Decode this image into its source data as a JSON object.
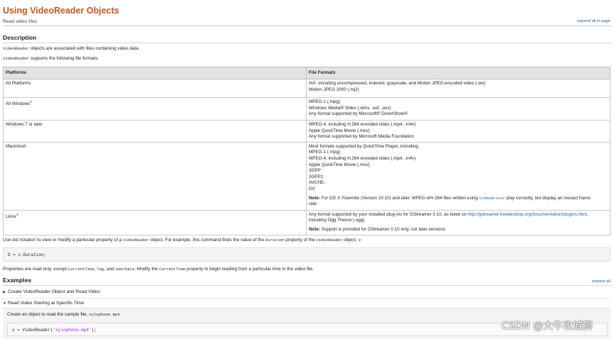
{
  "header": {
    "title": "Using VideoReader Objects",
    "subtitle": "Read video files",
    "expand_all_in_page": "expand all in page"
  },
  "description": {
    "heading": "Description",
    "line1_code": "VideoReader",
    "line1_text": " objects are associated with files containing video data.",
    "line2_code": "VideoReader",
    "line2_text": " supports the following file formats."
  },
  "formats_table": {
    "headers": [
      "Platforms",
      "File Formats"
    ],
    "rows": [
      {
        "platform": "All Platforms",
        "sup": "",
        "lines": [
          "AVI, including uncompressed, indexed, grayscale, and Motion JPEG-encoded video (.avi)",
          "Motion JPEG 2000 (.mj2)"
        ]
      },
      {
        "platform": "All Windows",
        "sup": "®",
        "lines": [
          "MPEG-1 (.mpg)",
          "Windows Media® Video (.wmv, .asf, .asx)",
          "Any format supported by Microsoft® DirectShow®"
        ]
      },
      {
        "platform": "Windows 7 or later",
        "sup": "",
        "lines": [
          "MPEG-4, including H.264 encoded video (.mp4, .m4v)",
          "Apple QuickTime Movie (.mov)",
          "Any format supported by Microsoft Media Foundation"
        ]
      },
      {
        "platform": "Macintosh",
        "sup": "",
        "lines": [
          "Most formats supported by QuickTime Player, including:",
          "MPEG-1 (.mpg)",
          "MPEG-4, including H.264 encoded video (.mp4, .m4v)",
          "Apple QuickTime Movie (.mov)",
          "3GPP",
          "3GPP2",
          "AVCHD",
          "DV"
        ],
        "note_label": "Note:",
        "note_text": " For OS X Yosemite (Version 10.10) and later, MPEG-4/H.264 files written using ",
        "note_code": "VideoWriter",
        "note_text2": " play correctly, but display an inexact frame",
        "note_text3": "rate."
      },
      {
        "platform": "Linux",
        "sup": "®",
        "line1_pre": "Any format supported by your installed plug-ins for GStreamer 0.10, as listed on ",
        "line1_link": "http://gstreamer.freedesktop.org/documentation/plugins.html",
        "line1_post": ",",
        "line2": "including Ogg Theora (.ogg).",
        "note_label": "Note:",
        "note_text": " Support is provided for GStreamer 0.10 only, not later versions."
      }
    ]
  },
  "dot_notation": {
    "t1": "Use dot notation to view or modify a particular property of a ",
    "c1": "VideoReader",
    "t2": " object. For example, this command finds the value of the ",
    "c2": "Duration",
    "t3": " property of the ",
    "c3": "VideoReader",
    "t4": " object, ",
    "c4": "v",
    "t5": "."
  },
  "code1": "D = v.Duration;",
  "properties_note": {
    "t1": "Properties are read only, except ",
    "c1": "CurrentTime",
    "t2": ", ",
    "c2": "Tag",
    "t3": ", and ",
    "c3": "UserData",
    "t4": ". Modify the ",
    "c4": "CurrentTime",
    "t5": " property to begin reading from a particular time in the video file."
  },
  "examples": {
    "heading": "Examples",
    "expand_all": "expand all",
    "items": [
      {
        "label": "Create VideoReader Object and Read Video",
        "expanded": false
      },
      {
        "label": "Read Video Starting at Specific Time",
        "expanded": true
      }
    ],
    "intro_text": "Create an object to read the sample file, ",
    "intro_code": "xylophone.mp4",
    "intro_end": ".",
    "code_pre": "v = VideoReader(",
    "code_str": "'xylophone.mp4'",
    "code_post": ");"
  },
  "watermark": "CSDN @大牛攻城狮"
}
